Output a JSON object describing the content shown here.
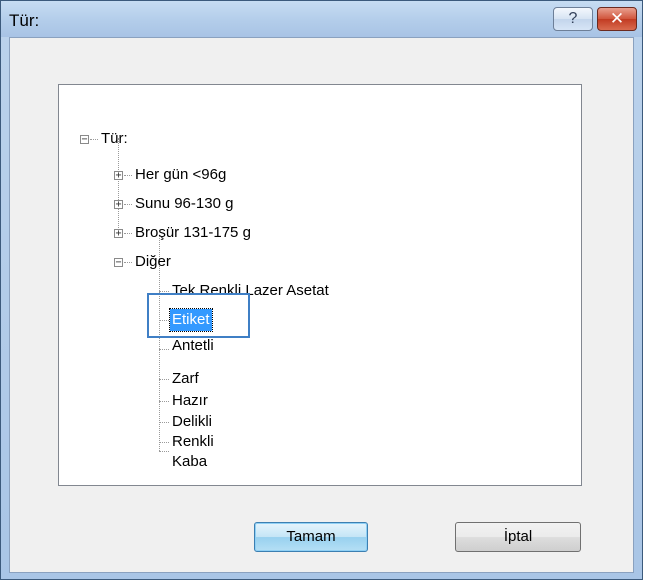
{
  "window": {
    "title": "Tür:",
    "help_label": "?",
    "close_label": "✕"
  },
  "tree": {
    "root": {
      "label": "Tür:",
      "expander": "−",
      "children": [
        {
          "label": "Her gün <96g",
          "expander": "+"
        },
        {
          "label": "Sunu 96-130 g",
          "expander": "+"
        },
        {
          "label": "Broşür 131-175 g",
          "expander": "+"
        },
        {
          "label": "Diğer",
          "expander": "−",
          "children": [
            {
              "label": "Tek Renkli Lazer Asetat"
            },
            {
              "label": "Etiket",
              "selected": true
            },
            {
              "label": "Antetli"
            },
            {
              "label": "Zarf"
            },
            {
              "label": "Hazır"
            },
            {
              "label": "Delikli"
            },
            {
              "label": "Renkli"
            },
            {
              "label": "Kaba"
            }
          ]
        }
      ]
    }
  },
  "buttons": {
    "ok_label": "Tamam",
    "cancel_label": "İptal"
  },
  "colors": {
    "selection": "#3399ff",
    "highlight_box": "#3f7fc5",
    "close_button": "#c23b22"
  }
}
